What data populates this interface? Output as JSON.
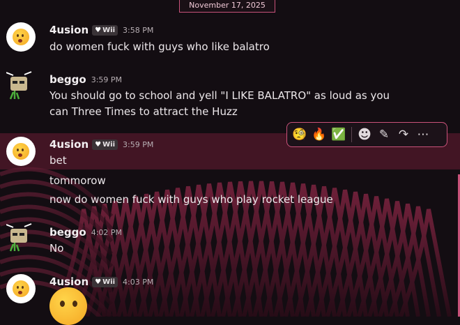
{
  "date_divider": "November 17, 2025",
  "accent_color": "#c9527a",
  "messages": [
    {
      "username": "4usion",
      "tag": "Wii",
      "time": "3:58 PM",
      "lines": [
        "do women fuck with guys who like balatro"
      ]
    },
    {
      "username": "beggo",
      "time": "3:59 PM",
      "lines": [
        "You should go to school and yell \"I LIKE BALATRO\" as loud as you",
        "can Three Times to attract the Huzz"
      ]
    },
    {
      "username": "4usion",
      "tag": "Wii",
      "time": "3:59 PM",
      "lines": [
        "bet"
      ]
    },
    {
      "lines": [
        "tommorow",
        "now do women fuck with guys who play rocket league"
      ]
    },
    {
      "username": "beggo",
      "time": "4:02 PM",
      "lines": [
        "No"
      ]
    },
    {
      "username": "4usion",
      "tag": "Wii",
      "time": "4:03 PM",
      "emoji": "frowning-face-emoji"
    }
  ],
  "toolbar": {
    "reactions": [
      {
        "icon": "monocle-face-icon",
        "glyph": "🧐"
      },
      {
        "icon": "fire-icon",
        "glyph": "🔥"
      },
      {
        "icon": "check-mark-icon",
        "glyph": "✅"
      }
    ],
    "actions": [
      {
        "icon": "add-reaction-icon",
        "glyph": "☻"
      },
      {
        "icon": "edit-pencil-icon",
        "glyph": "✎"
      },
      {
        "icon": "reply-arrow-icon",
        "glyph": "↷"
      },
      {
        "icon": "more-options-icon",
        "glyph": "⋯"
      }
    ]
  }
}
